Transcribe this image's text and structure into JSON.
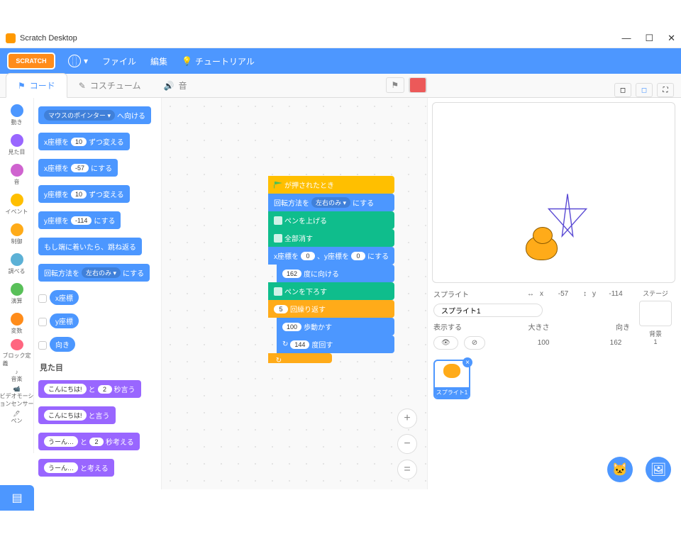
{
  "window": {
    "title": "Scratch Desktop"
  },
  "menu": {
    "file": "ファイル",
    "edit": "編集",
    "tutorials": "チュートリアル",
    "logo": "SCRATCH"
  },
  "tabs": {
    "code": "コード",
    "costumes": "コスチューム",
    "sounds": "音"
  },
  "categories": [
    {
      "name": "動き",
      "color": "#4c97ff"
    },
    {
      "name": "見た目",
      "color": "#9966ff"
    },
    {
      "name": "音",
      "color": "#cf63cf"
    },
    {
      "name": "イベント",
      "color": "#ffbf00"
    },
    {
      "name": "制御",
      "color": "#ffab19"
    },
    {
      "name": "調べる",
      "color": "#5cb1d6"
    },
    {
      "name": "演算",
      "color": "#59c059"
    },
    {
      "name": "変数",
      "color": "#ff8c1a"
    },
    {
      "name": "ブロック定義",
      "color": "#ff6680"
    }
  ],
  "extracat": [
    {
      "name": "音楽"
    },
    {
      "name": "ビデオモーションセンサー"
    },
    {
      "name": "ペン"
    }
  ],
  "palette": {
    "mouse_ptr": "マウスのポインター ▾",
    "goto_suffix": "へ向ける",
    "changex": "x座標を",
    "by": "ずつ変える",
    "setx": "x座標を",
    "to": "にする",
    "changey": "y座標を",
    "sety": "y座標を",
    "bounce": "もし端に着いたら、跳ね返る",
    "rotstyle": "回転方法を",
    "rotval": "左右のみ ▾",
    "rotsuffix": "にする",
    "xpos": "x座標",
    "ypos": "y座標",
    "dir": "向き",
    "looks_header": "見た目",
    "say1": "こんにちは!",
    "say_and": "と",
    "secs": "秒言う",
    "say": "と言う",
    "think": "うーん…",
    "think_secs": "秒考える",
    "think2": "と考える",
    "v10": "10",
    "vn57": "-57",
    "vn114": "-114",
    "v2": "2"
  },
  "script": {
    "when_clicked": "が押されたとき",
    "set_rot": "回転方法を",
    "rot_val": "左右のみ ▾",
    "rot_suf": "にする",
    "pen_up": "ペンを上げる",
    "erase": "全部消す",
    "gotoxy_x": "x座標を",
    "gotoxy_y": "、y座標を",
    "gotoxy_suf": "にする",
    "zero": "0",
    "point": "度に向ける",
    "pdeg": "162",
    "pen_down": "ペンを下ろす",
    "repeat": "回繰り返す",
    "rcount": "5",
    "move": "歩動かす",
    "msteps": "100",
    "turn": "度回す",
    "tdeg": "144"
  },
  "sprite": {
    "label": "スプライト",
    "name": "スプライト1",
    "x_lbl": "x",
    "x": "-57",
    "y_lbl": "y",
    "y": "-114",
    "show": "表示する",
    "size_lbl": "大きさ",
    "size": "100",
    "dir_lbl": "向き",
    "dir": "162"
  },
  "stage": {
    "label": "ステージ",
    "backdrops": "背景",
    "count": "1"
  }
}
